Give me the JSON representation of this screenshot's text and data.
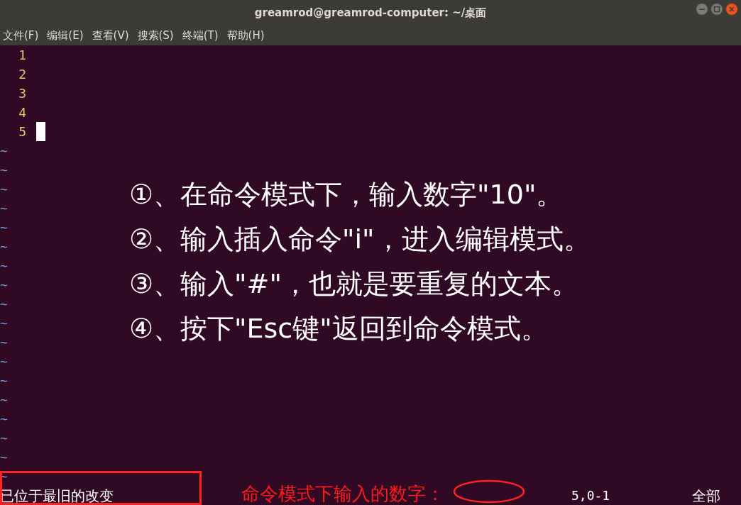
{
  "window": {
    "title": "greamrod@greamrod-computer: ~/桌面"
  },
  "menu": [
    "文件(F)",
    "编辑(E)",
    "查看(V)",
    "搜索(S)",
    "终端(T)",
    "帮助(H)"
  ],
  "editor": {
    "lines": [
      {
        "number": "1",
        "cursor": false
      },
      {
        "number": "2",
        "cursor": false
      },
      {
        "number": "3",
        "cursor": false
      },
      {
        "number": "4",
        "cursor": false
      },
      {
        "number": "5",
        "cursor": true
      }
    ],
    "filler_lines": [
      "~",
      "~",
      "~",
      "~",
      "~",
      "~",
      "~",
      "~",
      "~",
      "~",
      "~",
      "~",
      "~",
      "~",
      "~",
      "~",
      "~",
      "~"
    ]
  },
  "annotation": {
    "steps": [
      "①、在命令模式下，输入数字\"10\"。",
      "②、输入插入命令\"i\"，进入编辑模式。",
      "③、输入\"#\"，也就是要重复的文本。",
      "④、按下\"Esc键\"返回到命令模式。"
    ],
    "note": "命令模式下输入的数字："
  },
  "status_line": {
    "message": "已位于最旧的改变",
    "position": "5,0-1",
    "scroll": "全部"
  }
}
